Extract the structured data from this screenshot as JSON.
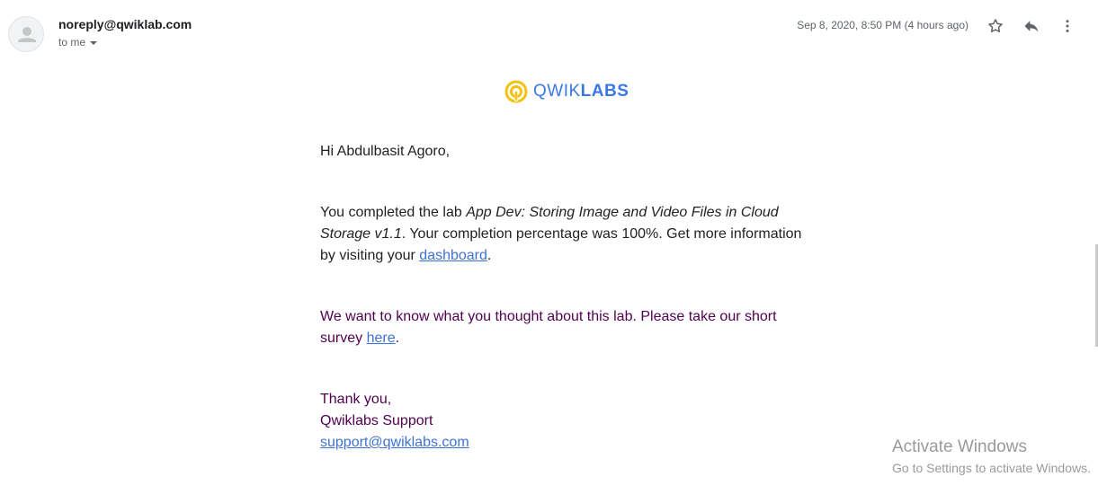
{
  "header": {
    "sender": "noreply@qwiklab.com",
    "recipient": "to me",
    "date": "Sep 8, 2020, 8:50 PM (4 hours ago)"
  },
  "icons": {
    "avatar": "default-avatar-icon",
    "star": "star-icon",
    "reply": "reply-icon",
    "more": "more-vert-icon",
    "caret": "chevron-down-icon",
    "logo": "qwiklabs-logo-icon"
  },
  "logo": {
    "word_light": "QWIK",
    "word_bold": "LABS",
    "colors": {
      "mark": "#f4c20d",
      "text": "#3b78e7"
    }
  },
  "body": {
    "greeting": "Hi Abdulbasit Agoro,",
    "p1_start": "You completed the lab ",
    "p1_lab": "App Dev: Storing Image and Video Files in Cloud Storage v1.1",
    "p1_mid": ". Your completion percentage was 100%. Get more information by visiting your ",
    "p1_link": "dashboard",
    "p1_end": ".",
    "p2_start": "We want to know what you thought about this lab. Please take our short survey ",
    "p2_link": "here",
    "p2_end": ".",
    "signoff": "Thank you,",
    "team": "Qwiklabs Support",
    "email_link": "support@qwiklabs.com"
  },
  "watermark": {
    "line1": "Activate Windows",
    "line2": "Go to Settings to activate Windows."
  },
  "colors": {
    "link": "#3d72d6",
    "visited_text": "#500050",
    "meta": "#5f6368"
  }
}
